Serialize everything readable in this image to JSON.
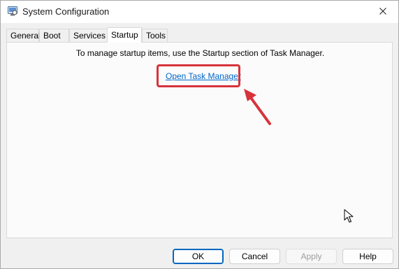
{
  "window": {
    "title": "System Configuration",
    "icon": "msconfig-icon",
    "close_icon": "close-icon"
  },
  "tabs": [
    {
      "label": "General",
      "active": false
    },
    {
      "label": "Boot",
      "active": false
    },
    {
      "label": "Services",
      "active": false
    },
    {
      "label": "Startup",
      "active": true
    },
    {
      "label": "Tools",
      "active": false
    }
  ],
  "startup_panel": {
    "info_text": "To manage startup items, use the Startup section of Task Manager.",
    "link_text": "Open Task Manager"
  },
  "annotation": {
    "highlight_color": "#d7333b"
  },
  "buttons": {
    "ok": "OK",
    "cancel": "Cancel",
    "apply": "Apply",
    "help": "Help"
  }
}
